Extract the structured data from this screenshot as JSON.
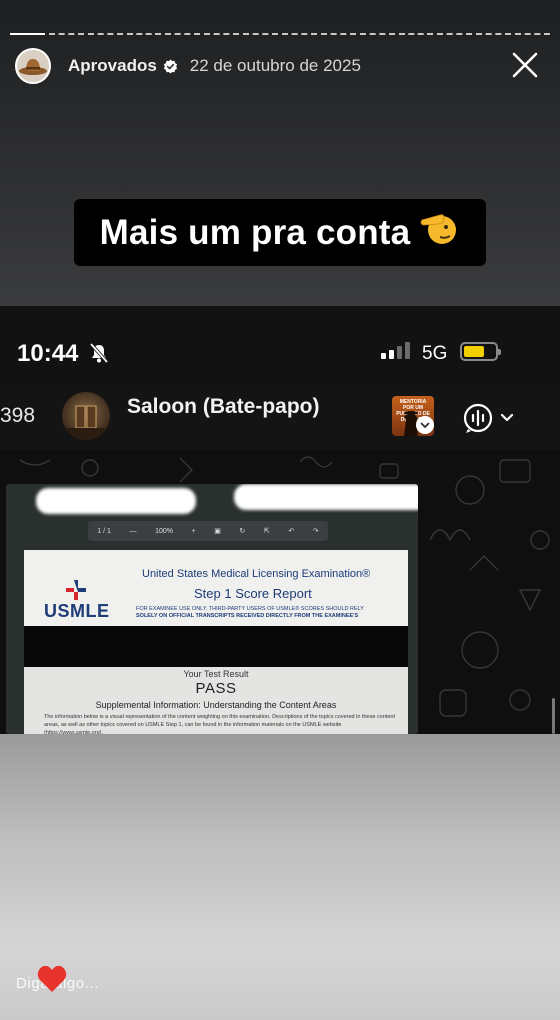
{
  "story": {
    "progress_segments": 14,
    "active_segments": 1,
    "username": "Aprovados",
    "date": "22 de outubro de 2025",
    "caption": "Mais um pra conta",
    "caption_emoji": "🫡",
    "reply_placeholder": "Diga algo...",
    "icons": {
      "avatar": "cowboy-hat-icon",
      "verified": "verified-badge-icon",
      "close": "close-icon",
      "like": "heart-icon"
    },
    "colors": {
      "heart": "#e8332c",
      "verified": "#ffffff"
    }
  },
  "screenshot": {
    "status": {
      "time": "10:44",
      "network": "5G",
      "battery_level": 0.65,
      "icons": [
        "bell-slash-icon",
        "signal-icon",
        "battery-icon"
      ]
    },
    "chat": {
      "unread_count": "398",
      "group_name": "Saloon (Bate-papo)",
      "thumbnail_text": "MENTORIA POR UM PUNHADO DE DÓLARES",
      "icons": [
        "back-icon",
        "group-avatar",
        "voice-chat-icon",
        "chevron-down-icon"
      ]
    },
    "document": {
      "toolbar": [
        "1 / 1",
        "—",
        "100%",
        "+",
        "▣",
        "↻",
        "⇱",
        "↶",
        "↷"
      ],
      "logo": "USMLE",
      "title_line1": "United States Medical Licensing Examination®",
      "title_line2": "Step 1 Score Report",
      "notice_line1": "FOR EXAMINEE USE ONLY. THIRD-PARTY USERS OF USMLE® SCORES SHOULD RELY",
      "notice_line2": "SOLELY ON OFFICIAL TRANSCRIPTS RECEIVED DIRECTLY FROM THE EXAMINEE'S",
      "result_label": "Your Test Result",
      "result": "PASS",
      "supplemental": "Supplemental Information: Understanding the Content Areas",
      "paragraph": "The information below is a visual representation of the content weighting on this examination. Descriptions of the topics covered in these content areas, as well as other topics covered on USMLE Step 1, can be found in the information materials on the USMLE website (https://www.usmle.org)."
    }
  }
}
